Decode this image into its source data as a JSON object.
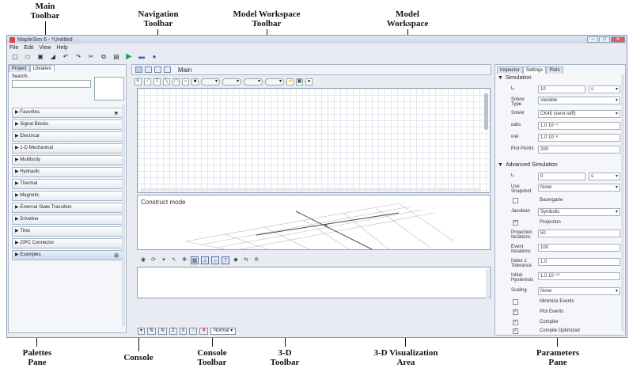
{
  "annotations": {
    "main_toolbar": [
      "Main",
      "Toolbar"
    ],
    "navigation_toolbar": [
      "Navigation",
      "Toolbar"
    ],
    "model_workspace_toolbar": [
      "Model Workspace",
      "Toolbar"
    ],
    "model_workspace": [
      "Model",
      "Workspace"
    ],
    "palettes_pane": [
      "Palettes",
      "Pane"
    ],
    "console": [
      "Console"
    ],
    "console_toolbar": [
      "Console",
      "Toolbar"
    ],
    "toolbar_3d": [
      "3-D",
      "Toolbar"
    ],
    "viz_area_3d": [
      "3-D Visualization",
      "Area"
    ],
    "parameters_pane": [
      "Parameters",
      "Pane"
    ]
  },
  "window": {
    "title": "MapleSim 6 - *Untitled",
    "menu": [
      "File",
      "Edit",
      "View",
      "Help"
    ]
  },
  "palettes": {
    "tabs": [
      "Project",
      "Libraries"
    ],
    "active_tab": "Libraries",
    "search_label": "Search:",
    "items": [
      "Favorites",
      "Signal Blocks",
      "Electrical",
      "1-D Mechanical",
      "Multibody",
      "Hydraulic",
      "Thermal",
      "Magnetic",
      "External State Transition",
      "Driveline",
      "Tires",
      "ZIPC Connector",
      "Examples"
    ]
  },
  "navigation": {
    "breadcrumb": "Main"
  },
  "viz": {
    "construct_mode": "Construct mode"
  },
  "console_toolbar": {
    "mode": "Normal"
  },
  "parameters": {
    "tabs": [
      "Inspector",
      "Settings",
      "Plots"
    ],
    "active_tab": "Settings",
    "simulation_title": "Simulation",
    "simulation_rows": [
      {
        "label": "tₑ",
        "value": "10",
        "unit": "s"
      },
      {
        "label": "Solver Type",
        "value": "Variable"
      },
      {
        "label": "Solver",
        "value": "CK45 (semi-stiff)"
      },
      {
        "label": "εabs",
        "value": "1.0 10⁻⁴"
      },
      {
        "label": "εrel",
        "value": "1.0 10⁻⁶"
      },
      {
        "label": "Plot Points",
        "value": "200"
      }
    ],
    "advanced_title": "Advanced Simulation",
    "advanced_rows": [
      {
        "label": "tₛ",
        "value": "0",
        "unit": "s"
      },
      {
        "label": "Use Snapshot",
        "value": "None"
      },
      {
        "label": "",
        "check_label": "Baumgarte",
        "checked": false
      },
      {
        "label": "Jacobian",
        "value": "Symbolic"
      },
      {
        "label": "",
        "check_label": "Projection",
        "checked": true
      },
      {
        "label": "Projection Iterations",
        "value": "50"
      },
      {
        "label": "Event Iterations",
        "value": "100"
      },
      {
        "label": "Index 1 Tolerance",
        "value": "1.0"
      },
      {
        "label": "Initial Hysteresis",
        "value": "1.0 10⁻¹⁰"
      },
      {
        "label": "Scaling",
        "value": "None"
      },
      {
        "label": "",
        "check_label": "Minimize Events",
        "checked": false
      },
      {
        "label": "",
        "check_label": "Plot Events",
        "checked": true
      },
      {
        "label": "",
        "check_label": "Compiler",
        "checked": true
      },
      {
        "label": "",
        "check_label": "Compile Optimized",
        "checked": true
      }
    ]
  }
}
